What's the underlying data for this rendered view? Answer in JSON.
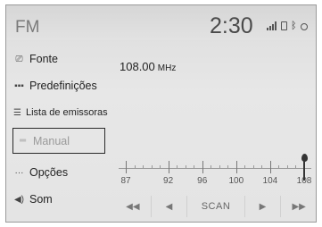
{
  "header": {
    "title": "FM",
    "clock": "2:30"
  },
  "status_icons": [
    "signal-icon",
    "battery-icon",
    "bluetooth-icon",
    "circle-status-icon"
  ],
  "menu": [
    {
      "label": "Fonte",
      "icon": "source-icon",
      "glyph": "⎚"
    },
    {
      "label": "Predefinições",
      "icon": "presets-icon",
      "glyph": "▪▪▪"
    },
    {
      "label": "Lista de emissoras",
      "icon": "station-list-icon",
      "glyph": "☰"
    },
    {
      "label": "Manual",
      "icon": "manual-tune-icon",
      "glyph": "═"
    },
    {
      "label": "Opções",
      "icon": "options-icon",
      "glyph": "···"
    },
    {
      "label": "Som",
      "icon": "speaker-icon",
      "glyph": "◀)"
    }
  ],
  "selected_menu": "Manual",
  "frequency": {
    "value": "108.00",
    "unit": "MHz"
  },
  "scale": {
    "ticks": [
      "87",
      "92",
      "96",
      "100",
      "104",
      "108"
    ],
    "min": 87,
    "max": 108,
    "current": 108
  },
  "controls": {
    "seek_back": "◀◀",
    "step_back": "◀",
    "scan": "SCAN",
    "step_forward": "▶",
    "seek_forward": "▶▶"
  }
}
